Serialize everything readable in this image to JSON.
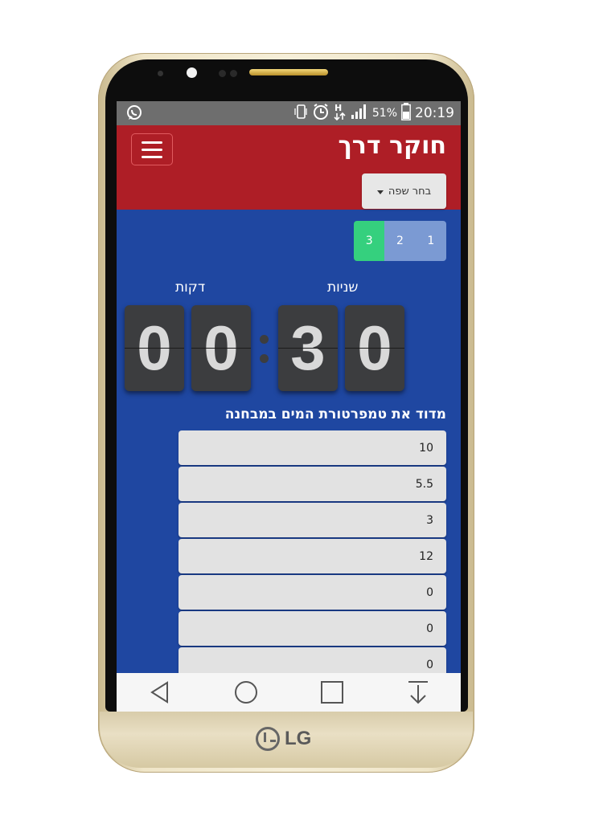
{
  "device": {
    "brand": "LG"
  },
  "status_bar": {
    "battery": "51%",
    "time": "20:19",
    "icons": [
      "whatsapp-icon",
      "vibrate-icon",
      "alarm-icon",
      "hplus-data-icon",
      "signal-icon",
      "battery-icon"
    ]
  },
  "header": {
    "title": "חוקר דרך",
    "language_button": "בחר שפה",
    "background": "#ae1e26"
  },
  "pager": {
    "pages": [
      "1",
      "2",
      "3"
    ],
    "active": "3"
  },
  "timer": {
    "minutes_label": "דקות",
    "seconds_label": "שניות",
    "digits": [
      "0",
      "0",
      "3",
      "0"
    ]
  },
  "question": {
    "text": "מדוד את טמפרטורת המים במבחנה",
    "answers": [
      "10",
      "5.5",
      "3",
      "12",
      "0",
      "0",
      "0"
    ]
  },
  "nav_bar": {
    "buttons": [
      "back-icon",
      "home-icon",
      "recents-icon",
      "notification-pull-icon"
    ]
  },
  "colors": {
    "screen_bg": "#1f47a1",
    "active_page": "#35d07e",
    "inactive_page": "#7b9ad3"
  }
}
